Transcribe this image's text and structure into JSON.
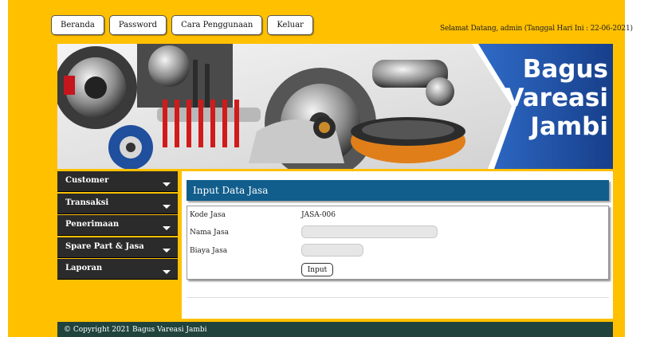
{
  "nav": {
    "items": [
      "Beranda",
      "Password",
      "Cara Penggunaan",
      "Keluar"
    ]
  },
  "header": {
    "welcome": "Selamat Datang, admin (Tanggal Hari Ini : 22-06-2021)"
  },
  "banner": {
    "brand_line1": "Bagus",
    "brand_line2": "Vareasi",
    "brand_line3": "Jambi",
    "colors": {
      "blue": "#1d4e9e",
      "bg": "#ffc000"
    }
  },
  "sidebar": {
    "items": [
      "Customer",
      "Transaksi",
      "Penerimaan",
      "Spare Part & Jasa",
      "Laporan"
    ]
  },
  "main": {
    "title": "Input Data Jasa",
    "form": {
      "kode_label": "Kode Jasa",
      "kode_value": "JASA-006",
      "nama_label": "Nama Jasa",
      "nama_value": "",
      "biaya_label": "Biaya Jasa",
      "biaya_value": "",
      "submit_label": "Input"
    }
  },
  "footer": {
    "text": "© Copyright 2021 Bagus Vareasi Jambi"
  }
}
